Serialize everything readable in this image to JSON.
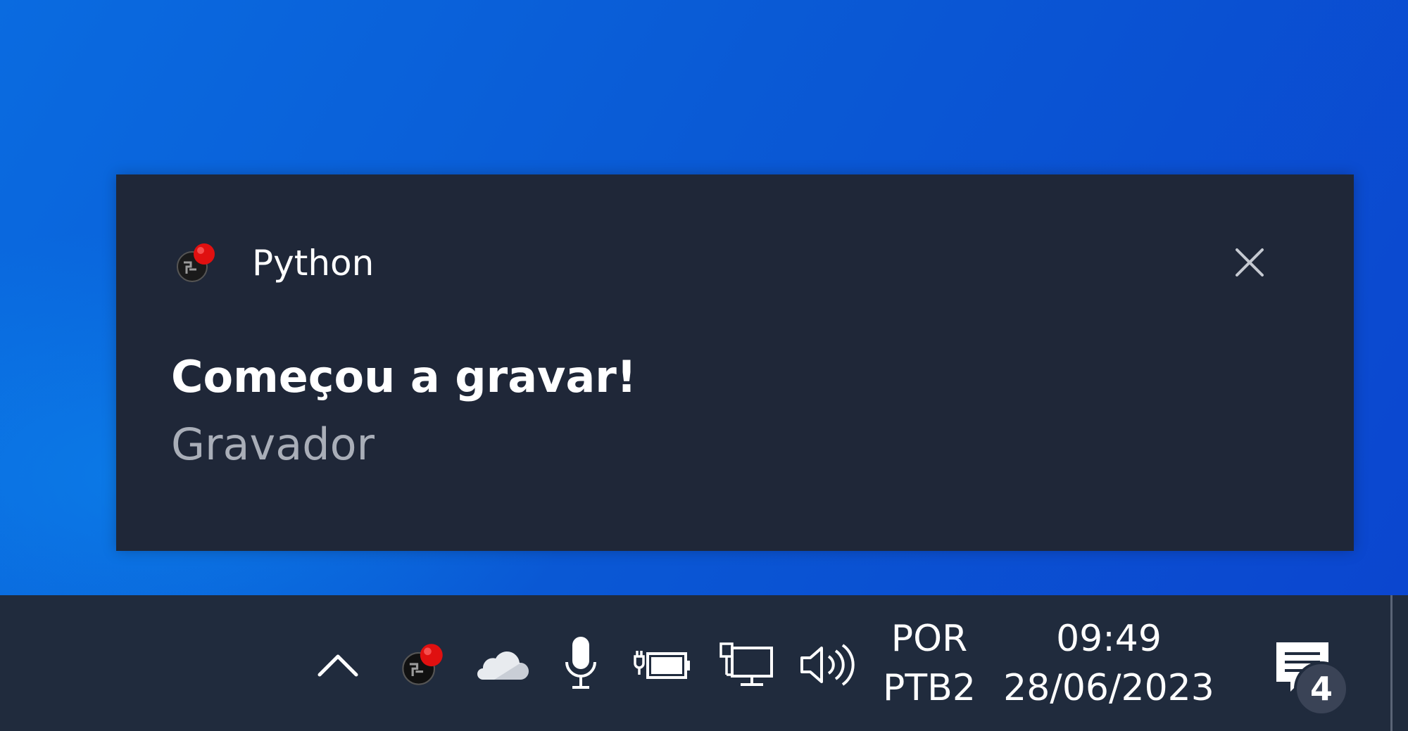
{
  "notification": {
    "app_name": "Python",
    "title": "Começou a gravar!",
    "body": "Gravador",
    "app_icon": "recorder-app-icon",
    "close_icon": "close-icon"
  },
  "taskbar": {
    "tray_icons": [
      {
        "name": "chevron-up-icon"
      },
      {
        "name": "recorder-app-icon"
      },
      {
        "name": "onedrive-cloud-icon"
      },
      {
        "name": "microphone-icon"
      },
      {
        "name": "power-battery-icon"
      },
      {
        "name": "network-icon"
      },
      {
        "name": "volume-icon"
      }
    ],
    "language": "POR",
    "keyboard_layout": "PTB2",
    "time": "09:49",
    "date": "28/06/2023",
    "notification_count": "4",
    "action_center_icon": "action-center-icon"
  }
}
